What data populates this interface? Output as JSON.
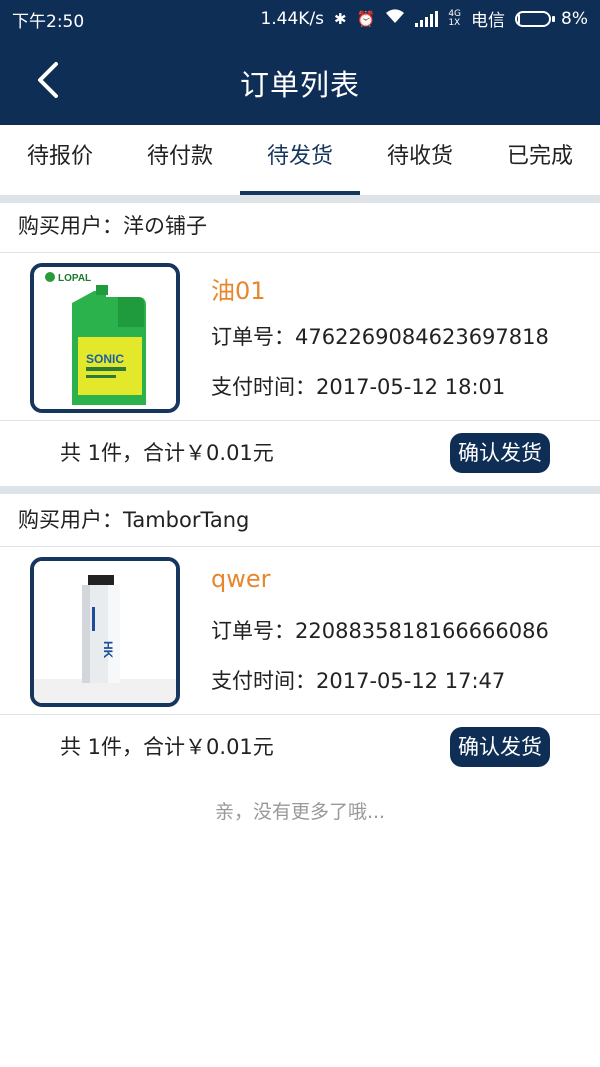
{
  "status_bar": {
    "time": "下午2:50",
    "speed": "1.44K/s",
    "network_top": "4G",
    "network_bottom": "1X",
    "carrier": "电信",
    "battery": "8%",
    "battery_level": 0.08
  },
  "header": {
    "title": "订单列表"
  },
  "tabs": [
    {
      "label": "待报价",
      "active": false
    },
    {
      "label": "待付款",
      "active": false
    },
    {
      "label": "待发货",
      "active": true
    },
    {
      "label": "待收货",
      "active": false
    },
    {
      "label": "已完成",
      "active": false
    }
  ],
  "orders": [
    {
      "buyer": "购买用户：洋の铺子",
      "product_name": "油01",
      "order_no": "订单号：4762269084623697818",
      "pay_time": "支付时间：2017-05-12 18:01",
      "summary": "共 1件，合计￥0.01元",
      "action": "确认发货",
      "image_icon": "oil-bottle-icon",
      "image_brand": "LOPAL",
      "image_text": "SONIC"
    },
    {
      "buyer": "购买用户：TamborTang",
      "product_name": "qwer",
      "order_no": "订单号：2208835818166666086",
      "pay_time": "支付时间：2017-05-12 17:47",
      "summary": "共 1件，合计￥0.01元",
      "action": "确认发货",
      "image_icon": "fuel-filter-icon",
      "image_brand": "HK"
    }
  ],
  "footer_text": "亲，没有更多了哦...",
  "colors": {
    "primary": "#0e2e55",
    "accent_orange": "#e8862e",
    "divider": "#dde3e6"
  }
}
